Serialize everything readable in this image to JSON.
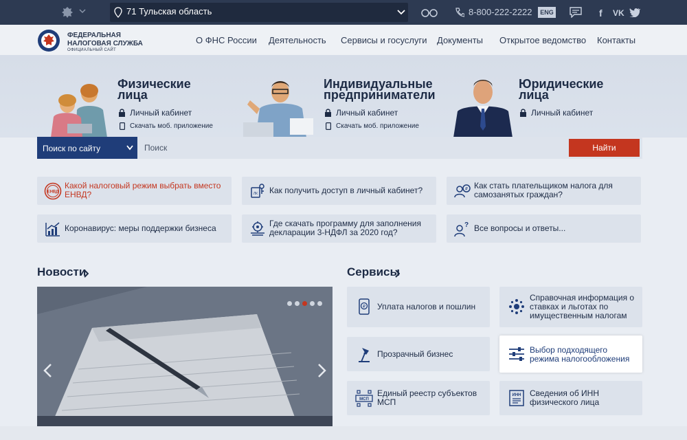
{
  "topbar": {
    "region": "71 Тульская область",
    "phone": "8-800-222-2222",
    "lang_button": "ENG",
    "social": {
      "fb": "f",
      "vk": "VK"
    }
  },
  "logo": {
    "line1": "ФЕДЕРАЛЬНАЯ",
    "line2": "НАЛОГОВАЯ СЛУЖБА",
    "line3": "ОФИЦИАЛЬНЫЙ САЙТ"
  },
  "nav": [
    "О ФНС России",
    "Деятельность",
    "Сервисы и госуслуги",
    "Документы",
    "Открытое ведомство",
    "Контакты"
  ],
  "hero": {
    "individuals": {
      "title_1": "Физические",
      "title_2": "лица",
      "cabinet": "Личный кабинет",
      "app": "Скачать моб. приложение"
    },
    "entrepreneurs": {
      "title_1": "Индивидуальные",
      "title_2": "предприниматели",
      "cabinet": "Личный кабинет",
      "app": "Скачать моб. приложение"
    },
    "legal": {
      "title_1": "Юридические",
      "title_2": "лица",
      "cabinet": "Личный кабинет"
    }
  },
  "search": {
    "dropdown": "Поиск по сайту",
    "placeholder": "Поиск",
    "button": "Найти"
  },
  "quick_links": [
    {
      "text": "Какой налоговый режим выбрать вместо ЕНВД?",
      "icon": "envd-badge-icon",
      "highlight": true
    },
    {
      "text": "Как получить доступ в личный кабинет?",
      "icon": "cabinet-key-icon"
    },
    {
      "text": "Как стать плательщиком налога для самозанятых граждан?",
      "icon": "self-employed-icon"
    },
    {
      "text": "Коронавирус: меры поддержки бизнеса",
      "icon": "chart-growth-icon"
    },
    {
      "text": "Где скачать программу для заполнения декларации 3-НДФЛ за 2020 год?",
      "icon": "gear-doc-icon"
    },
    {
      "text": "Все вопросы и ответы...",
      "icon": "question-person-icon"
    }
  ],
  "sections": {
    "news": "Новости",
    "services": "Сервисы"
  },
  "news_slider": {
    "slides": 5,
    "active": 3
  },
  "services": [
    {
      "text": "Уплата налогов и пошлин",
      "icon": "ruble-phone-icon"
    },
    {
      "text": "Справочная информация о ставках и льготах по имущественным налогам",
      "icon": "emblem-info-icon"
    },
    {
      "text": "Прозрачный бизнес",
      "icon": "lamp-icon"
    },
    {
      "text": "Выбор подходящего режима налогообложения",
      "icon": "sliders-icon",
      "highlight": true
    },
    {
      "text": "Единый реестр субъектов МСП",
      "icon": "msp-registry-icon"
    },
    {
      "text": "Сведения об ИНН физического лица",
      "icon": "inn-doc-icon"
    }
  ],
  "colors": {
    "primary": "#1f3d79",
    "accent": "#c4361f",
    "topbar": "#2d3a52"
  }
}
